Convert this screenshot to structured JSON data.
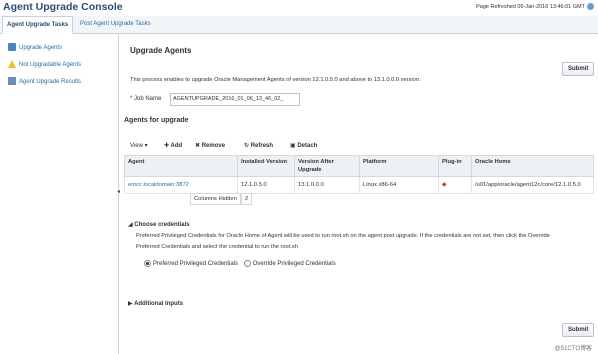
{
  "header": {
    "title": "Agent Upgrade Console",
    "refresh": "Page Refreshed 06-Jan-2016 13:46:01 GMT"
  },
  "tabs": [
    "Agent Upgrade Tasks",
    "Post Agent Upgrade Tasks"
  ],
  "sidebar": {
    "items": [
      {
        "label": "Upgrade Agents",
        "icon": "upgrade-icon"
      },
      {
        "label": "Not Upgradable Agents",
        "icon": "warning-icon"
      },
      {
        "label": "Agent Upgrade Results",
        "icon": "results-icon"
      }
    ]
  },
  "main": {
    "title": "Upgrade Agents",
    "submit": "Submit",
    "description": "This process enables to upgrade Oracle Management Agents of version 12.1.0.5.0 and above to 13.1.0.0.0 version.",
    "job_name_label": "* Job Name",
    "job_name_value": "AGENTUPGRADE_2016_01_06_13_46_02_",
    "agents_title": "Agents for upgrade",
    "toolbar": {
      "view": "View ▾",
      "add": "Add",
      "remove": "Remove",
      "refresh": "Refresh",
      "detach": "Detach"
    },
    "table": {
      "headers": [
        "Agent",
        "Installed Version",
        "Version After Upgrade",
        "Platform",
        "Plug-in",
        "Oracle Home"
      ],
      "rows": [
        [
          "emcc.localdomain:3872",
          "12.1.0.5.0",
          "13.1.0.0.0",
          "Linux x86-64",
          "",
          "/u01/app/oracle/agent12c/core/12.1.0.5.0"
        ]
      ]
    },
    "columns_hidden_label": "Columns Hidden",
    "columns_hidden_value": "2",
    "credentials": {
      "title": "Choose credentials",
      "text1": "Preferred Privileged Credentials for Oracle Home of Agent will be used to run root.sh on the agent post upgrade. If the credentials are not set, then click the Override",
      "text2": "Preferred Credentials and select the credential to run the root.sh",
      "radio1": "Preferred Privileged Credentials",
      "radio2": "Override Privileged Credentials"
    },
    "additional_inputs": "Additional Inputs"
  },
  "watermark": "@51CTO博客"
}
